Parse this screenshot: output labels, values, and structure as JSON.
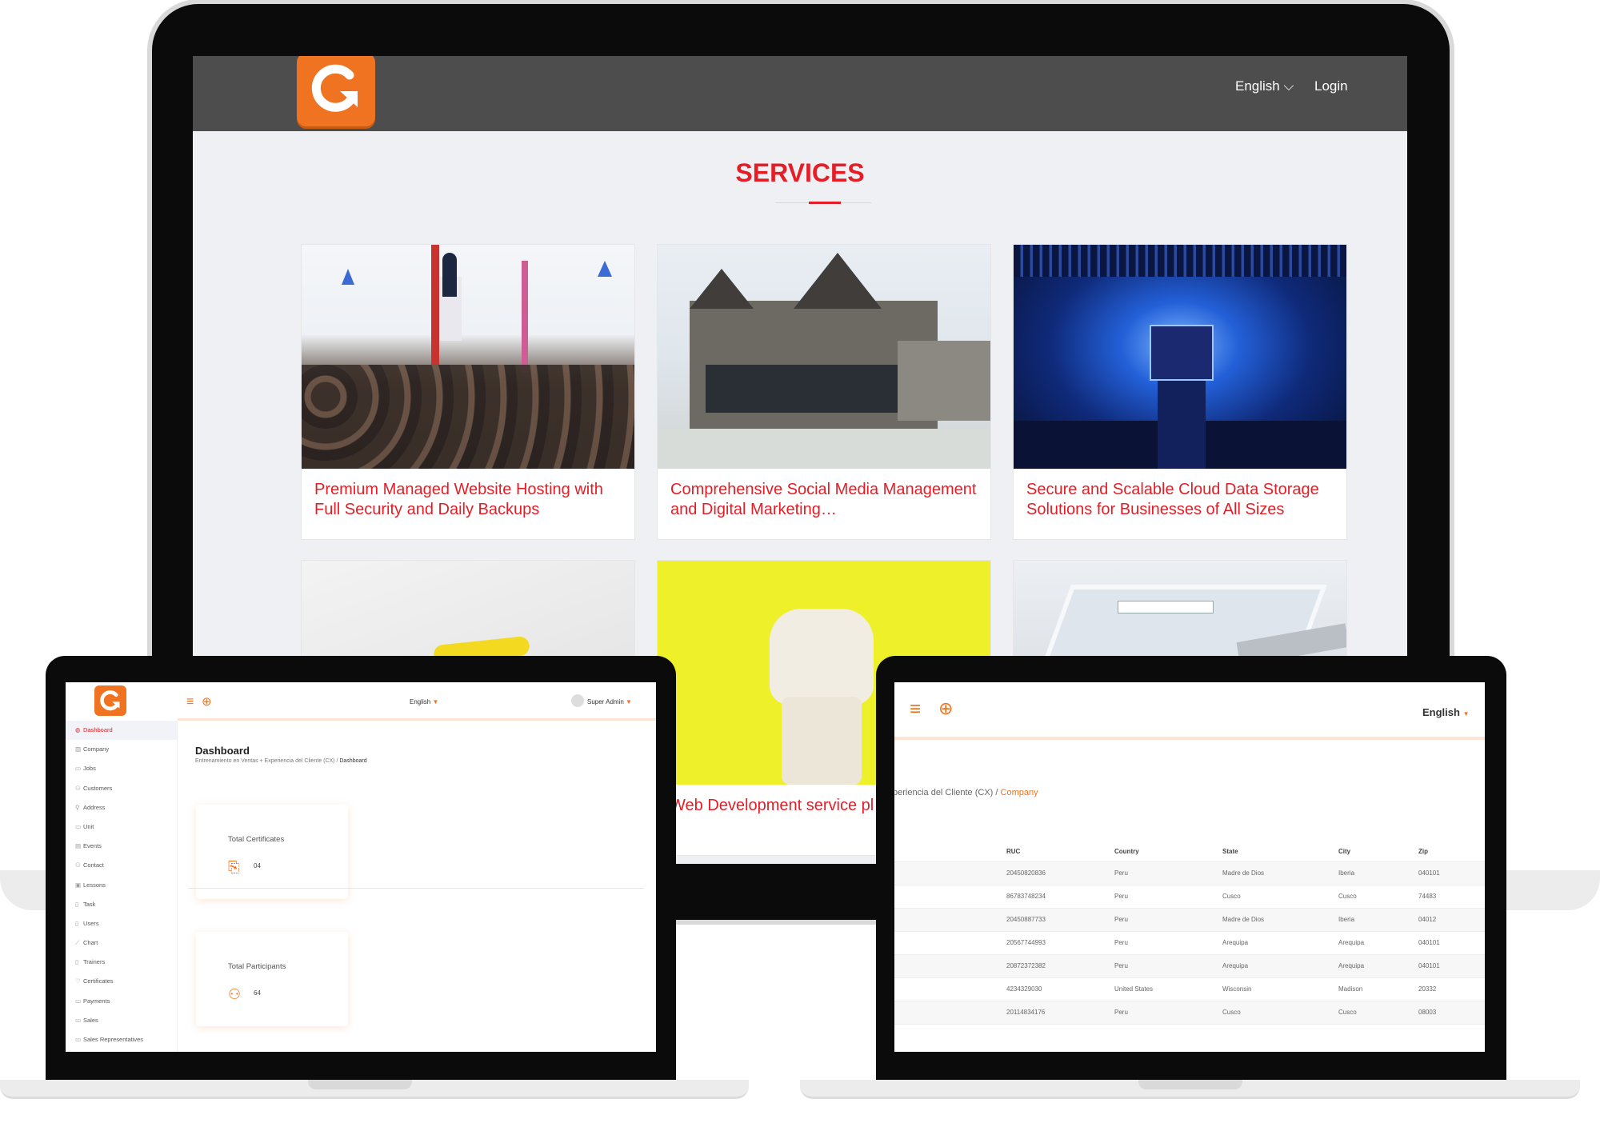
{
  "services_site": {
    "header": {
      "language": "English",
      "login": "Login"
    },
    "title": "SERVICES",
    "cards": [
      {
        "caption": "Premium Managed Website Hosting with Full Security and Daily Backups",
        "image": "conference-audience-image"
      },
      {
        "caption": "Comprehensive Social Media Management and Digital Marketing…",
        "image": "modern-house-image"
      },
      {
        "caption": "Secure and Scalable Cloud Data Storage Solutions for Businesses of All Sizes",
        "image": "concert-stage-image"
      },
      {
        "caption": "",
        "image": "document-with-highlighter-image"
      },
      {
        "caption": "Web Development service pl",
        "image": "gloved-fist-image"
      },
      {
        "caption": "",
        "image": "tablet-with-search-image"
      }
    ]
  },
  "dashboard": {
    "topbar": {
      "language": "English",
      "user": "Super Admin"
    },
    "sidebar": [
      {
        "label": "Dashboard",
        "active": true
      },
      {
        "label": "Company"
      },
      {
        "label": "Jobs"
      },
      {
        "label": "Customers"
      },
      {
        "label": "Address"
      },
      {
        "label": "Unit"
      },
      {
        "label": "Events"
      },
      {
        "label": "Contact"
      },
      {
        "label": "Lessons"
      },
      {
        "label": "Task"
      },
      {
        "label": "Users"
      },
      {
        "label": "Chart"
      },
      {
        "label": "Trainers"
      },
      {
        "label": "Certificates"
      },
      {
        "label": "Payments"
      },
      {
        "label": "Sales"
      },
      {
        "label": "Sales Representatives"
      }
    ],
    "title": "Dashboard",
    "breadcrumb": {
      "path": "Entrenamiento en Ventas + Experiencia del Cliente (CX) / ",
      "current": "Dashboard"
    },
    "stats": [
      {
        "label": "Total Certificates",
        "value": "04"
      },
      {
        "label": "Total Participants",
        "value": "64"
      }
    ]
  },
  "company": {
    "topbar": {
      "language": "English"
    },
    "breadcrumb": {
      "path": "periencia del Cliente (CX) / ",
      "current": "Company"
    },
    "table": {
      "columns": [
        "RUC",
        "Country",
        "State",
        "City",
        "Zip"
      ],
      "rows": [
        [
          "20450820836",
          "Peru",
          "Madre de Dios",
          "Iberia",
          "040101"
        ],
        [
          "86783748234",
          "Peru",
          "Cusco",
          "Cusco",
          "74483"
        ],
        [
          "20450887733",
          "Peru",
          "Madre de Dios",
          "Iberia",
          "04012"
        ],
        [
          "20567744993",
          "Peru",
          "Arequipa",
          "Arequipa",
          "040101"
        ],
        [
          "20872372382",
          "Peru",
          "Arequipa",
          "Arequipa",
          "040101"
        ],
        [
          "4234329030",
          "United States",
          "Wisconsin",
          "Madison",
          "20332"
        ],
        [
          "20114834176",
          "Peru",
          "Cusco",
          "Cusco",
          "08003"
        ]
      ]
    }
  },
  "colors": {
    "brand_orange": "#f07321",
    "accent_red": "#e51d26",
    "header_gray": "#4d4d4d"
  }
}
